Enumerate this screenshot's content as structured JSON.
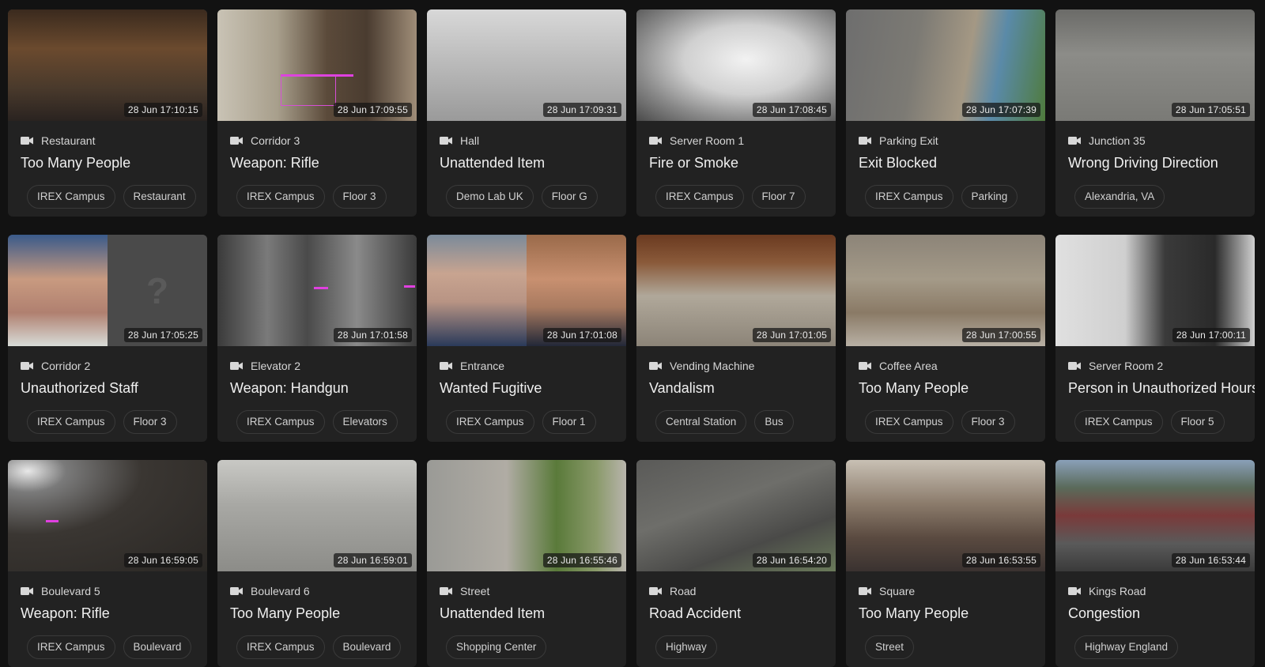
{
  "cards": [
    {
      "camera": "Restaurant",
      "event": "Too Many People",
      "timestamp": "28 Jun 17:10:15",
      "tags": [
        "IREX Campus",
        "Restaurant"
      ],
      "scene": "restaurant"
    },
    {
      "camera": "Corridor 3",
      "event": "Weapon: Rifle",
      "timestamp": "28 Jun 17:09:55",
      "tags": [
        "IREX Campus",
        "Floor 3"
      ],
      "scene": "corridor"
    },
    {
      "camera": "Hall",
      "event": "Unattended Item",
      "timestamp": "28 Jun 17:09:31",
      "tags": [
        "Demo Lab UK",
        "Floor G"
      ],
      "scene": "hall"
    },
    {
      "camera": "Server Room 1",
      "event": "Fire or Smoke",
      "timestamp": "28 Jun 17:08:45",
      "tags": [
        "IREX Campus",
        "Floor 7"
      ],
      "scene": "smoke"
    },
    {
      "camera": "Parking Exit",
      "event": "Exit Blocked",
      "timestamp": "28 Jun 17:07:39",
      "tags": [
        "IREX Campus",
        "Parking"
      ],
      "scene": "parking"
    },
    {
      "camera": "Junction 35",
      "event": "Wrong Driving Direction",
      "timestamp": "28 Jun 17:05:51",
      "tags": [
        "Alexandria, VA"
      ],
      "scene": "junction"
    },
    {
      "camera": "Corridor 2",
      "event": "Unauthorized Staff",
      "timestamp": "28 Jun 17:05:25",
      "tags": [
        "IREX Campus",
        "Floor 3"
      ],
      "scene": "unknown"
    },
    {
      "camera": "Elevator 2",
      "event": "Weapon: Handgun",
      "timestamp": "28 Jun 17:01:58",
      "tags": [
        "IREX Campus",
        "Elevators"
      ],
      "scene": "elevator"
    },
    {
      "camera": "Entrance",
      "event": "Wanted Fugitive",
      "timestamp": "28 Jun 17:01:08",
      "tags": [
        "IREX Campus",
        "Floor 1"
      ],
      "scene": "faces"
    },
    {
      "camera": "Vending Machine",
      "event": "Vandalism",
      "timestamp": "28 Jun 17:01:05",
      "tags": [
        "Central Station",
        "Bus"
      ],
      "scene": "vending"
    },
    {
      "camera": "Coffee Area",
      "event": "Too Many People",
      "timestamp": "28 Jun 17:00:55",
      "tags": [
        "IREX Campus",
        "Floor 3"
      ],
      "scene": "coffee"
    },
    {
      "camera": "Server Room 2",
      "event": "Person in Unauthorized Hours",
      "timestamp": "28 Jun 17:00:11",
      "tags": [
        "IREX Campus",
        "Floor 5"
      ],
      "scene": "server"
    },
    {
      "camera": "Boulevard 5",
      "event": "Weapon: Rifle",
      "timestamp": "28 Jun 16:59:05",
      "tags": [
        "IREX Campus",
        "Boulevard"
      ],
      "scene": "night"
    },
    {
      "camera": "Boulevard 6",
      "event": "Too Many People",
      "timestamp": "28 Jun 16:59:01",
      "tags": [
        "IREX Campus",
        "Boulevard"
      ],
      "scene": "plaza"
    },
    {
      "camera": "Street",
      "event": "Unattended Item",
      "timestamp": "28 Jun 16:55:46",
      "tags": [
        "Shopping Center"
      ],
      "scene": "street"
    },
    {
      "camera": "Road",
      "event": "Road Accident",
      "timestamp": "28 Jun 16:54:20",
      "tags": [
        "Highway"
      ],
      "scene": "road"
    },
    {
      "camera": "Square",
      "event": "Too Many People",
      "timestamp": "28 Jun 16:53:55",
      "tags": [
        "Street"
      ],
      "scene": "crowd"
    },
    {
      "camera": "Kings Road",
      "event": "Congestion",
      "timestamp": "28 Jun 16:53:44",
      "tags": [
        "Highway England"
      ],
      "scene": "traffic"
    }
  ]
}
